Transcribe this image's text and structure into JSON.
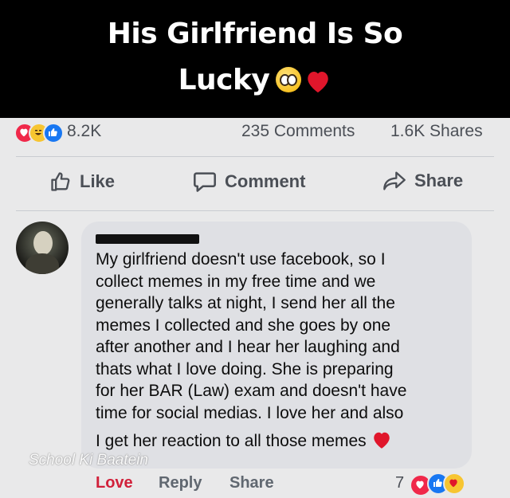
{
  "banner": {
    "title_line1": "His Girlfriend Is So",
    "title_line2": "Lucky",
    "emojis": [
      "pleading-face-icon",
      "red-heart-icon"
    ]
  },
  "post_stats": {
    "reaction_icons": [
      "love-icon",
      "haha-icon",
      "like-icon"
    ],
    "reactions_count": "8.2K",
    "comments_count": "235 Comments",
    "shares_count": "1.6K Shares"
  },
  "actions": {
    "like_label": "Like",
    "comment_label": "Comment",
    "share_label": "Share"
  },
  "comment": {
    "lines": [
      "My girlfriend doesn't use facebook, so I",
      "collect memes in my free time and we",
      "generally talks at night, I send her all the",
      "memes I collected and she goes by one",
      "after another and I hear her laughing and",
      "thats what I love doing. She is preparing",
      "for her BAR (Law) exam and doesn't have",
      "time for social medias. I love her and also"
    ],
    "last_line": "I get her reaction to all those memes",
    "footer": {
      "love_label": "Love",
      "reply_label": "Reply",
      "share_label": "Share",
      "reaction_count": "7",
      "reaction_icons": [
        "love-icon",
        "like-icon",
        "care-icon"
      ]
    }
  },
  "watermark": "School Ki Baatein",
  "colors": {
    "facebook_blue": "#1877f2",
    "love_red": "#f0284a",
    "bubble_gray": "#dfe0e4",
    "text_gray": "#4b4f56"
  }
}
